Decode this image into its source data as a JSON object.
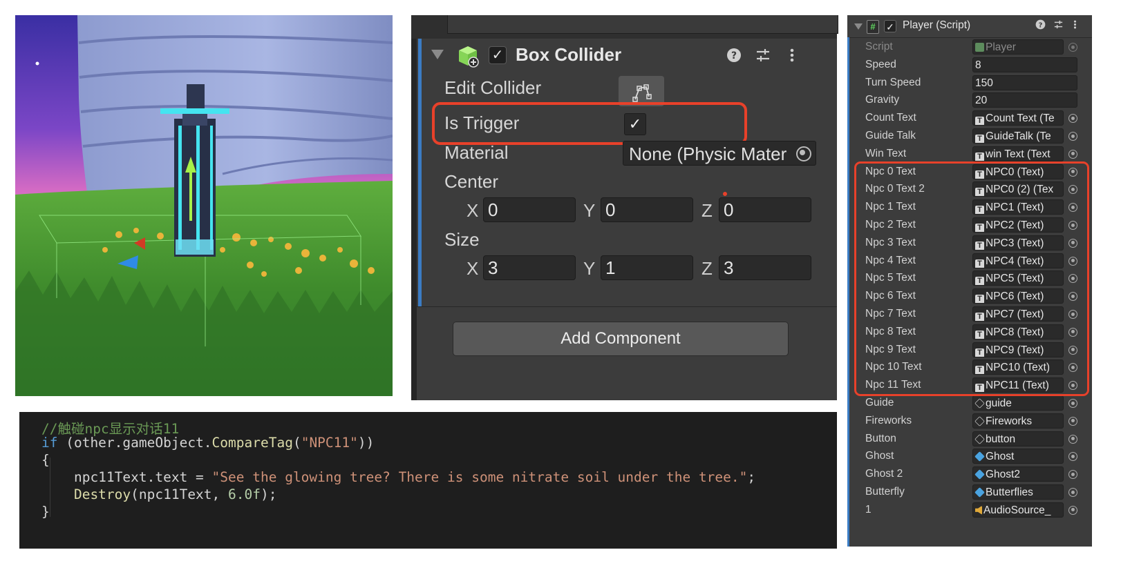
{
  "collider": {
    "title": "Box Collider",
    "edit_collider_label": "Edit Collider",
    "is_trigger_label": "Is Trigger",
    "is_trigger_checked": true,
    "material_label": "Material",
    "material_value": "None (Physic Mater",
    "center_label": "Center",
    "center": {
      "x": "0",
      "y": "0",
      "z": "0"
    },
    "size_label": "Size",
    "size": {
      "x": "3",
      "y": "1",
      "z": "3"
    },
    "axis": {
      "x": "X",
      "y": "Y",
      "z": "Z"
    },
    "add_component_label": "Add Component",
    "enabled_glyph": "✓"
  },
  "code": {
    "comment": "//触碰npc显示对话11",
    "kw_if": "if",
    "paren_open": " (other.gameObject.",
    "method": "CompareTag",
    "p2": "(",
    "tag": "\"NPC11\"",
    "p3": "))",
    "brace_open": "{",
    "assign_lhs": "    npc11Text.text = ",
    "assign_str": "\"See the glowing tree? There is some nitrate soil under the tree.\"",
    "semi": ";",
    "destroy_fn": "    Destroy",
    "destroy_args_a": "(npc11Text, ",
    "destroy_num": "6.0f",
    "destroy_args_b": ");",
    "brace_close": "}"
  },
  "player": {
    "title": "Player (Script)",
    "icon_glyph": "#",
    "enabled_glyph": "✓",
    "rows": [
      {
        "label": "Script",
        "value": "Player",
        "kind": "script",
        "disabled": true
      },
      {
        "label": "Speed",
        "value": "8",
        "kind": "num"
      },
      {
        "label": "Turn Speed",
        "value": "150",
        "kind": "num"
      },
      {
        "label": "Gravity",
        "value": "20",
        "kind": "num"
      },
      {
        "label": "Count Text",
        "value": "Count Text (Te",
        "kind": "text"
      },
      {
        "label": "Guide Talk",
        "value": "GuideTalk (Te",
        "kind": "text"
      },
      {
        "label": "Win Text",
        "value": "win Text (Text",
        "kind": "text"
      },
      {
        "label": "Npc 0 Text",
        "value": "NPC0 (Text)",
        "kind": "text"
      },
      {
        "label": "Npc 0 Text 2",
        "value": "NPC0 (2) (Tex",
        "kind": "text"
      },
      {
        "label": "Npc 1 Text",
        "value": "NPC1 (Text)",
        "kind": "text"
      },
      {
        "label": "Npc 2 Text",
        "value": "NPC2 (Text)",
        "kind": "text"
      },
      {
        "label": "Npc 3 Text",
        "value": "NPC3 (Text)",
        "kind": "text"
      },
      {
        "label": "Npc 4 Text",
        "value": "NPC4 (Text)",
        "kind": "text"
      },
      {
        "label": "Npc 5 Text",
        "value": "NPC5 (Text)",
        "kind": "text"
      },
      {
        "label": "Npc 6 Text",
        "value": "NPC6 (Text)",
        "kind": "text"
      },
      {
        "label": "Npc 7 Text",
        "value": "NPC7 (Text)",
        "kind": "text"
      },
      {
        "label": "Npc 8 Text",
        "value": "NPC8 (Text)",
        "kind": "text"
      },
      {
        "label": "Npc 9 Text",
        "value": "NPC9 (Text)",
        "kind": "text"
      },
      {
        "label": "Npc 10 Text",
        "value": "NPC10 (Text)",
        "kind": "text"
      },
      {
        "label": "Npc 11 Text",
        "value": "NPC11 (Text)",
        "kind": "text"
      },
      {
        "label": "Guide",
        "value": "guide",
        "kind": "gameobject"
      },
      {
        "label": "Fireworks",
        "value": "Fireworks",
        "kind": "gameobject"
      },
      {
        "label": "Button",
        "value": "button",
        "kind": "gameobject"
      },
      {
        "label": "Ghost",
        "value": "Ghost",
        "kind": "prefab"
      },
      {
        "label": "Ghost 2",
        "value": "Ghost2",
        "kind": "prefab"
      },
      {
        "label": "Butterfly",
        "value": "Butterflies",
        "kind": "prefab"
      },
      {
        "label": "1",
        "value": "AudioSource_",
        "kind": "audio"
      }
    ]
  },
  "colors": {
    "highlight_red": "#e8412a",
    "unity_blue_accent": "#3b7cc4",
    "panel_bg": "#3c3c3c",
    "code_bg": "#1e1e1e"
  }
}
